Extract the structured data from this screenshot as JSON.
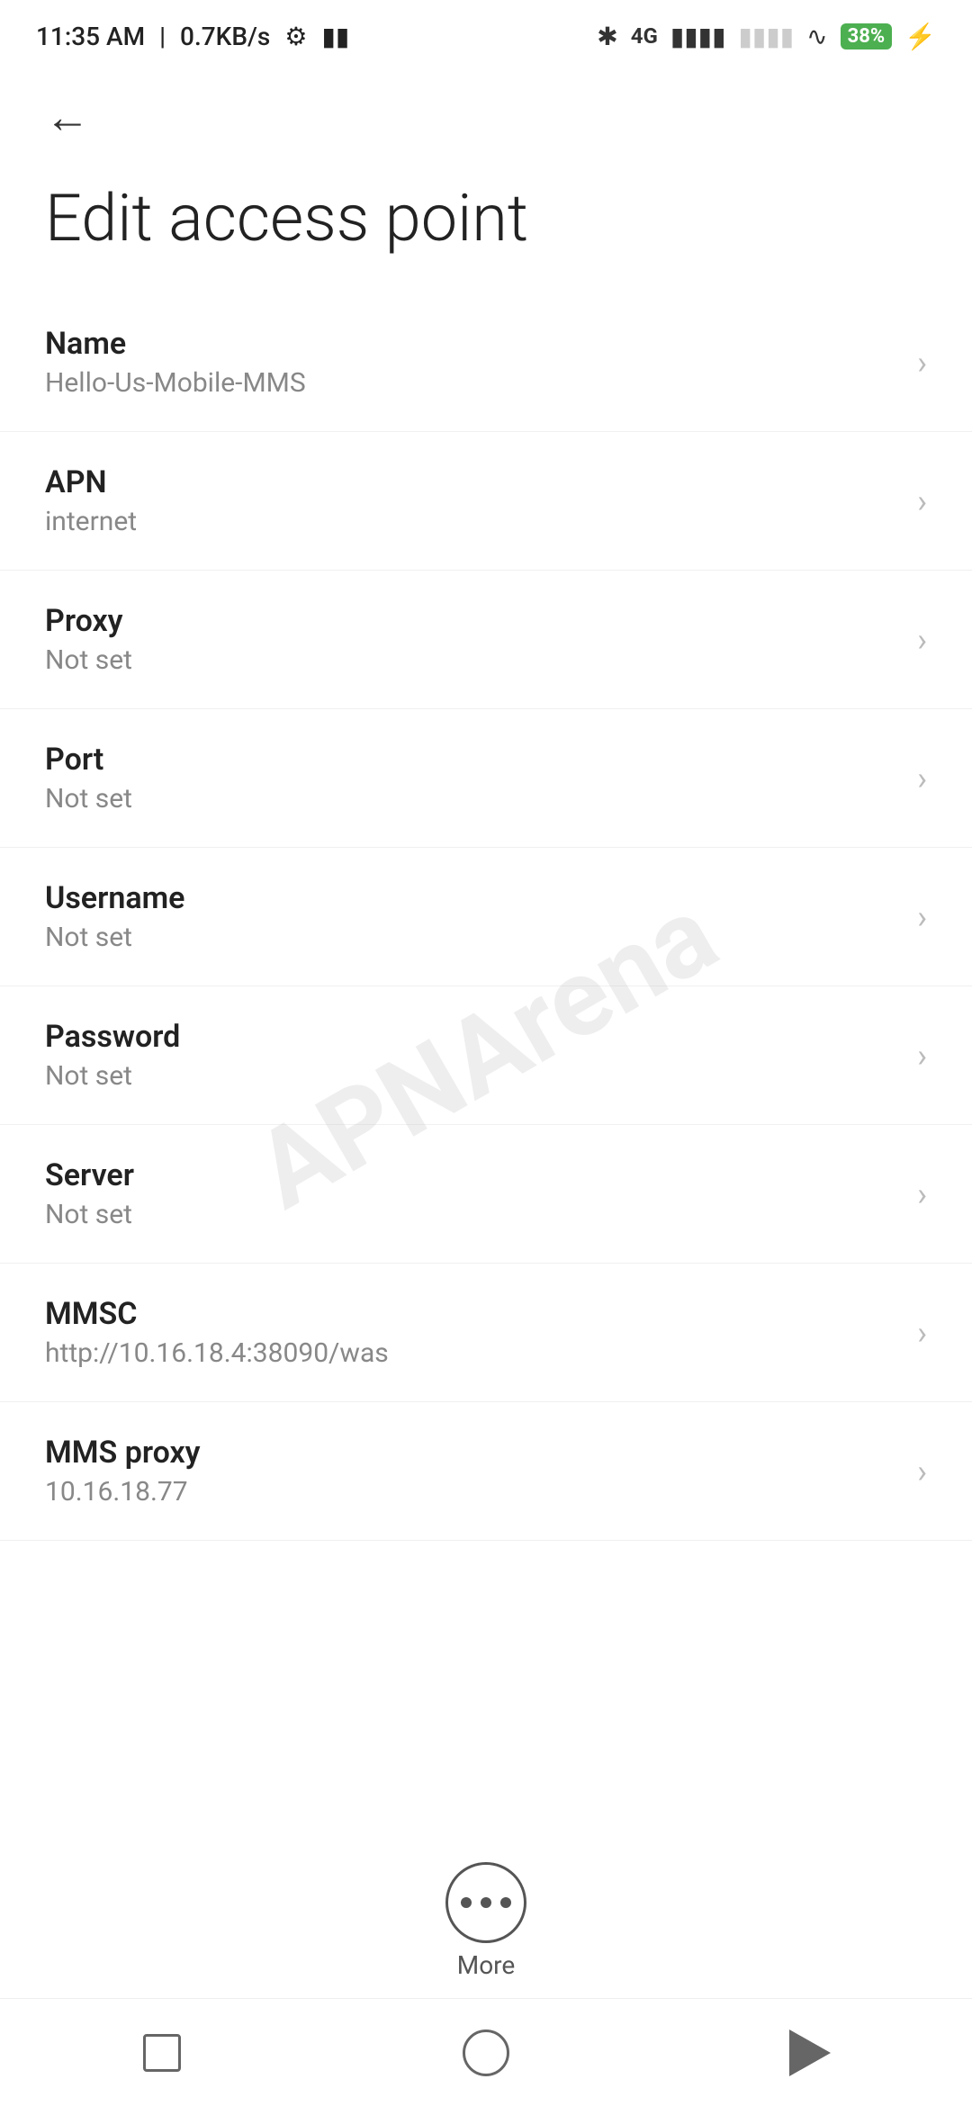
{
  "statusBar": {
    "time": "11:35 AM",
    "network": "0.7KB/s",
    "battery": "38"
  },
  "page": {
    "title": "Edit access point",
    "backLabel": "Back"
  },
  "settings": [
    {
      "id": "name",
      "label": "Name",
      "value": "Hello-Us-Mobile-MMS"
    },
    {
      "id": "apn",
      "label": "APN",
      "value": "internet"
    },
    {
      "id": "proxy",
      "label": "Proxy",
      "value": "Not set"
    },
    {
      "id": "port",
      "label": "Port",
      "value": "Not set"
    },
    {
      "id": "username",
      "label": "Username",
      "value": "Not set"
    },
    {
      "id": "password",
      "label": "Password",
      "value": "Not set"
    },
    {
      "id": "server",
      "label": "Server",
      "value": "Not set"
    },
    {
      "id": "mmsc",
      "label": "MMSC",
      "value": "http://10.16.18.4:38090/was"
    },
    {
      "id": "mms-proxy",
      "label": "MMS proxy",
      "value": "10.16.18.77"
    }
  ],
  "bottomBar": {
    "moreLabel": "More"
  },
  "watermark": "APNArena"
}
